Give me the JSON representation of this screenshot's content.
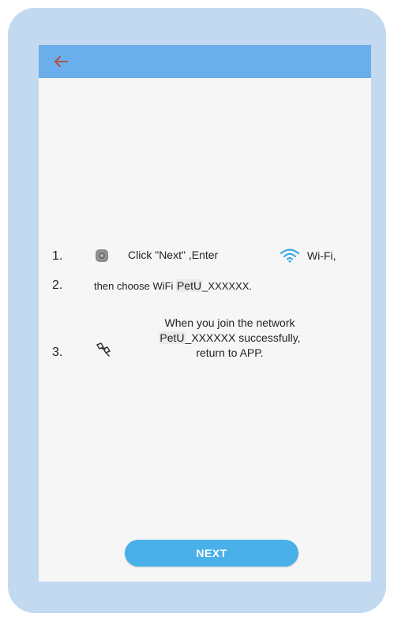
{
  "colors": {
    "frame": "#c2d9f0",
    "appbar": "#6aaeec",
    "screen_bg": "#f6f6f6",
    "back_arrow": "#b0524b",
    "wifi": "#3fa7e8",
    "next_button": "#49b0ea"
  },
  "appbar": {
    "back_icon": "arrow-left"
  },
  "steps": [
    {
      "number": "1.",
      "icon": "settings-gear",
      "text_before": "Click \"Next\" ,Enter",
      "icon2": "wifi",
      "text_after": "Wi-Fi,"
    },
    {
      "number": "2.",
      "text_before": "then choose WiFi ",
      "highlight": "PetU",
      "text_after": "_XXXXXX."
    },
    {
      "number": "3.",
      "icon": "link",
      "line1": "When you join the network",
      "highlight": "PetU",
      "line2_after": "_XXXXXX successfully,",
      "line3": "return to APP."
    }
  ],
  "next_button": {
    "label": "NEXT"
  }
}
